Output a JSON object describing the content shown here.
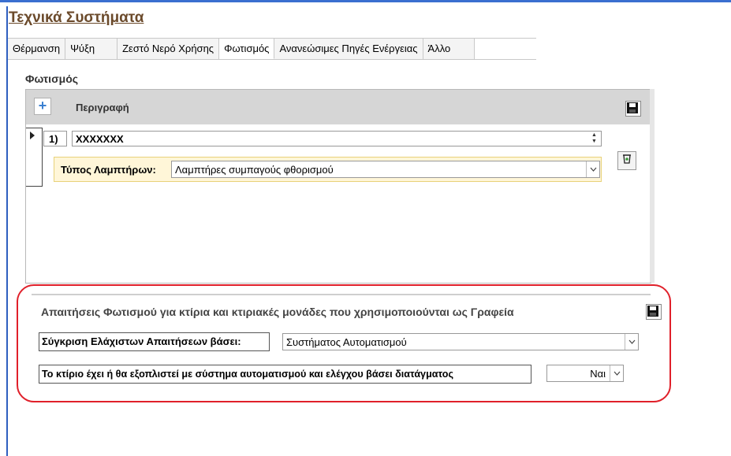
{
  "page": {
    "title": "Τεχνικά Συστήματα"
  },
  "tabs": [
    {
      "label": "Θέρμανση"
    },
    {
      "label": "Ψύξη"
    },
    {
      "label": "Ζεστό Νερό Χρήσης"
    },
    {
      "label": "Φωτισμός"
    },
    {
      "label": "Ανανεώσιμες Πηγές Ενέργειας"
    },
    {
      "label": "Άλλο"
    }
  ],
  "active_tab": "Φωτισμός",
  "section": {
    "label": "Φωτισμός"
  },
  "subform": {
    "add_icon": "plus-icon",
    "header_label": "Περιγραφή",
    "save_icon": "floppy-disk-icon",
    "record": {
      "row_number": "1)",
      "description": "XXXXXXX",
      "lamp_type_label": "Τύπος Λαμπτήρων:",
      "lamp_type_value": "Λαμπτήρες συμπαγούς φθορισμού",
      "delete_icon": "recycle-bin-icon"
    }
  },
  "requirements": {
    "title": "Απαιτήσεις Φωτισμού για κτίρια και κτιριακές μονάδες που χρησιμοποιούνται ως Γραφεία",
    "save_icon": "floppy-disk-icon",
    "compare_label": "Σύγκριση Ελάχιστων Απαιτήσεων βάσει:",
    "compare_value": "Συστήματος Αυτοματισμού",
    "automation_label": "Το κτίριο έχει ή θα εξοπλιστεί με σύστημα αυτοματισμού και ελέγχου βάσει διατάγματος",
    "automation_value": "Ναι"
  },
  "colors": {
    "highlight_frame": "#e0202a",
    "title_text": "#6b4a2b",
    "accent_line": "#3b6fd0"
  }
}
